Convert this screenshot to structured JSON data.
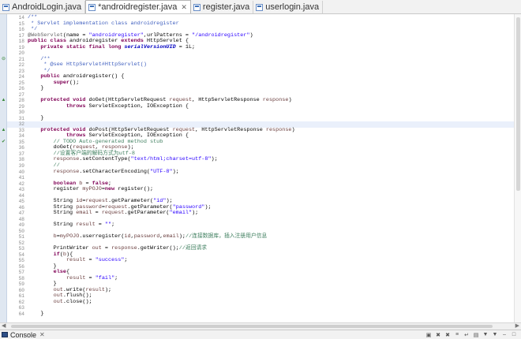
{
  "tabs": [
    {
      "label": "AndroidLogin.java",
      "active": false,
      "closable": false
    },
    {
      "label": "*androidregister.java",
      "active": true,
      "closable": true
    },
    {
      "label": "register.java",
      "active": false,
      "closable": false
    },
    {
      "label": "userlogin.java",
      "active": false,
      "closable": false
    }
  ],
  "code_lines": [
    {
      "n": "14",
      "m": "",
      "t": [
        {
          "c": "jd",
          "s": "/**"
        }
      ]
    },
    {
      "n": "15",
      "m": "",
      "t": [
        {
          "c": "jd",
          "s": " * Servlet implementation class androidregister"
        }
      ]
    },
    {
      "n": "16",
      "m": "",
      "t": [
        {
          "c": "jd",
          "s": " */"
        }
      ]
    },
    {
      "n": "17",
      "m": "",
      "t": [
        {
          "c": "ann",
          "s": "@WebServlet"
        },
        {
          "c": "pl",
          "s": "(name = "
        },
        {
          "c": "str",
          "s": "\"androidregister\""
        },
        {
          "c": "pl",
          "s": ",urlPatterns = "
        },
        {
          "c": "str",
          "s": "\"/androidregister\""
        },
        {
          "c": "pl",
          "s": ")"
        }
      ]
    },
    {
      "n": "18",
      "m": "",
      "t": [
        {
          "c": "kw",
          "s": "public class "
        },
        {
          "c": "pl",
          "s": "androidregister "
        },
        {
          "c": "kw",
          "s": "extends "
        },
        {
          "c": "pl",
          "s": "HttpServlet {"
        }
      ]
    },
    {
      "n": "19",
      "m": "",
      "t": [
        {
          "c": "pl",
          "s": "    "
        },
        {
          "c": "kw",
          "s": "private static final long "
        },
        {
          "c": "fld",
          "s": "serialVersionUID"
        },
        {
          "c": "pl",
          "s": " = 1L;"
        }
      ]
    },
    {
      "n": "20",
      "m": "",
      "t": []
    },
    {
      "n": "21",
      "m": "⊖",
      "t": [
        {
          "c": "pl",
          "s": "    "
        },
        {
          "c": "jd",
          "s": "/**"
        }
      ]
    },
    {
      "n": "22",
      "m": "",
      "t": [
        {
          "c": "jd",
          "s": "     * @see HttpServlet#HttpServlet()"
        }
      ]
    },
    {
      "n": "23",
      "m": "",
      "t": [
        {
          "c": "jd",
          "s": "     */"
        }
      ]
    },
    {
      "n": "24",
      "m": "",
      "t": [
        {
          "c": "pl",
          "s": "    "
        },
        {
          "c": "kw",
          "s": "public "
        },
        {
          "c": "pl",
          "s": "androidregister() {"
        }
      ]
    },
    {
      "n": "25",
      "m": "",
      "t": [
        {
          "c": "pl",
          "s": "        "
        },
        {
          "c": "kw",
          "s": "super"
        },
        {
          "c": "pl",
          "s": "();"
        }
      ]
    },
    {
      "n": "26",
      "m": "",
      "t": [
        {
          "c": "pl",
          "s": "    }"
        }
      ]
    },
    {
      "n": "27",
      "m": "",
      "t": []
    },
    {
      "n": "28",
      "m": "▲",
      "t": [
        {
          "c": "pl",
          "s": "    "
        },
        {
          "c": "kw",
          "s": "protected void "
        },
        {
          "c": "pl",
          "s": "doGet(HttpServletRequest "
        },
        {
          "c": "var",
          "s": "request"
        },
        {
          "c": "pl",
          "s": ", HttpServletResponse "
        },
        {
          "c": "var",
          "s": "response"
        },
        {
          "c": "pl",
          "s": ")"
        }
      ]
    },
    {
      "n": "29",
      "m": "",
      "t": [
        {
          "c": "pl",
          "s": "            "
        },
        {
          "c": "kw",
          "s": "throws "
        },
        {
          "c": "pl",
          "s": "ServletException, IOException {"
        }
      ]
    },
    {
      "n": "30",
      "m": "",
      "t": []
    },
    {
      "n": "31",
      "m": "",
      "t": [
        {
          "c": "pl",
          "s": "    }"
        }
      ]
    },
    {
      "n": "32",
      "m": "",
      "t": []
    },
    {
      "n": "33",
      "m": "▲",
      "t": [
        {
          "c": "pl",
          "s": "    "
        },
        {
          "c": "kw",
          "s": "protected void "
        },
        {
          "c": "pl",
          "s": "doPost(HttpServletRequest "
        },
        {
          "c": "var",
          "s": "request"
        },
        {
          "c": "pl",
          "s": ", HttpServletResponse "
        },
        {
          "c": "var",
          "s": "response"
        },
        {
          "c": "pl",
          "s": ")"
        }
      ]
    },
    {
      "n": "34",
      "m": "",
      "t": [
        {
          "c": "pl",
          "s": "            "
        },
        {
          "c": "kw",
          "s": "throws "
        },
        {
          "c": "pl",
          "s": "ServletException, IOException {"
        }
      ]
    },
    {
      "n": "35",
      "m": "✔",
      "t": [
        {
          "c": "pl",
          "s": "        "
        },
        {
          "c": "cm",
          "s": "// TODO Auto-generated method stub"
        }
      ]
    },
    {
      "n": "36",
      "m": "",
      "t": [
        {
          "c": "pl",
          "s": "        doGet("
        },
        {
          "c": "var",
          "s": "request"
        },
        {
          "c": "pl",
          "s": ", "
        },
        {
          "c": "var",
          "s": "response"
        },
        {
          "c": "pl",
          "s": ");"
        }
      ]
    },
    {
      "n": "37",
      "m": "",
      "t": [
        {
          "c": "pl",
          "s": "        "
        },
        {
          "c": "cm",
          "s": "//设置客户端的解码方式为utf-8"
        }
      ]
    },
    {
      "n": "38",
      "m": "",
      "t": [
        {
          "c": "pl",
          "s": "        "
        },
        {
          "c": "var",
          "s": "response"
        },
        {
          "c": "pl",
          "s": ".setContentType("
        },
        {
          "c": "str",
          "s": "\"text/html;charset=utf-8\""
        },
        {
          "c": "pl",
          "s": ");"
        }
      ]
    },
    {
      "n": "39",
      "m": "",
      "t": [
        {
          "c": "pl",
          "s": "        "
        },
        {
          "c": "cm",
          "s": "//"
        }
      ]
    },
    {
      "n": "40",
      "m": "",
      "t": [
        {
          "c": "pl",
          "s": "        "
        },
        {
          "c": "var",
          "s": "response"
        },
        {
          "c": "pl",
          "s": ".setCharacterEncoding("
        },
        {
          "c": "str",
          "s": "\"UTF-8\""
        },
        {
          "c": "pl",
          "s": ");"
        }
      ]
    },
    {
      "n": "41",
      "m": "",
      "t": []
    },
    {
      "n": "42",
      "m": "",
      "t": [
        {
          "c": "pl",
          "s": "        "
        },
        {
          "c": "kw",
          "s": "boolean "
        },
        {
          "c": "var",
          "s": "b"
        },
        {
          "c": "pl",
          "s": " = "
        },
        {
          "c": "kw",
          "s": "false"
        },
        {
          "c": "pl",
          "s": ";"
        }
      ]
    },
    {
      "n": "43",
      "m": "",
      "t": [
        {
          "c": "pl",
          "s": "        register "
        },
        {
          "c": "var",
          "s": "myPOJO"
        },
        {
          "c": "pl",
          "s": "="
        },
        {
          "c": "kw",
          "s": "new "
        },
        {
          "c": "pl",
          "s": "register();"
        }
      ]
    },
    {
      "n": "44",
      "m": "",
      "t": []
    },
    {
      "n": "45",
      "m": "",
      "t": [
        {
          "c": "pl",
          "s": "        String "
        },
        {
          "c": "var",
          "s": "id"
        },
        {
          "c": "pl",
          "s": "="
        },
        {
          "c": "var",
          "s": "request"
        },
        {
          "c": "pl",
          "s": ".getParameter("
        },
        {
          "c": "str",
          "s": "\"id\""
        },
        {
          "c": "pl",
          "s": ");"
        }
      ]
    },
    {
      "n": "46",
      "m": "",
      "t": [
        {
          "c": "pl",
          "s": "        String "
        },
        {
          "c": "var",
          "s": "password"
        },
        {
          "c": "pl",
          "s": "="
        },
        {
          "c": "var",
          "s": "request"
        },
        {
          "c": "pl",
          "s": ".getParameter("
        },
        {
          "c": "str",
          "s": "\"password\""
        },
        {
          "c": "pl",
          "s": ");"
        }
      ]
    },
    {
      "n": "47",
      "m": "",
      "t": [
        {
          "c": "pl",
          "s": "        String "
        },
        {
          "c": "var",
          "s": "email"
        },
        {
          "c": "pl",
          "s": " = "
        },
        {
          "c": "var",
          "s": "request"
        },
        {
          "c": "pl",
          "s": ".getParameter("
        },
        {
          "c": "str",
          "s": "\"email\""
        },
        {
          "c": "pl",
          "s": ");"
        }
      ]
    },
    {
      "n": "48",
      "m": "",
      "t": []
    },
    {
      "n": "49",
      "m": "",
      "t": [
        {
          "c": "pl",
          "s": "        String "
        },
        {
          "c": "var",
          "s": "result"
        },
        {
          "c": "pl",
          "s": " = "
        },
        {
          "c": "str",
          "s": "\"\""
        },
        {
          "c": "pl",
          "s": ";"
        }
      ]
    },
    {
      "n": "50",
      "m": "",
      "t": []
    },
    {
      "n": "51",
      "m": "",
      "t": [
        {
          "c": "pl",
          "s": "        "
        },
        {
          "c": "var",
          "s": "b"
        },
        {
          "c": "pl",
          "s": "="
        },
        {
          "c": "var",
          "s": "myPOJO"
        },
        {
          "c": "pl",
          "s": ".userregister("
        },
        {
          "c": "var",
          "s": "id"
        },
        {
          "c": "pl",
          "s": ","
        },
        {
          "c": "var",
          "s": "password"
        },
        {
          "c": "pl",
          "s": ","
        },
        {
          "c": "var",
          "s": "email"
        },
        {
          "c": "pl",
          "s": ");"
        },
        {
          "c": "cm",
          "s": "//连接数据库，插入注册用户信息"
        }
      ]
    },
    {
      "n": "52",
      "m": "",
      "t": []
    },
    {
      "n": "53",
      "m": "",
      "t": [
        {
          "c": "pl",
          "s": "        PrintWriter "
        },
        {
          "c": "var",
          "s": "out"
        },
        {
          "c": "pl",
          "s": " = "
        },
        {
          "c": "var",
          "s": "response"
        },
        {
          "c": "pl",
          "s": ".getWriter();"
        },
        {
          "c": "cm",
          "s": "//返回请求"
        }
      ]
    },
    {
      "n": "54",
      "m": "",
      "t": [
        {
          "c": "pl",
          "s": "        "
        },
        {
          "c": "kw",
          "s": "if"
        },
        {
          "c": "pl",
          "s": "("
        },
        {
          "c": "var",
          "s": "b"
        },
        {
          "c": "pl",
          "s": "){"
        }
      ]
    },
    {
      "n": "55",
      "m": "",
      "t": [
        {
          "c": "pl",
          "s": "            "
        },
        {
          "c": "var",
          "s": "result"
        },
        {
          "c": "pl",
          "s": " = "
        },
        {
          "c": "str",
          "s": "\"success\""
        },
        {
          "c": "pl",
          "s": ";"
        }
      ]
    },
    {
      "n": "56",
      "m": "",
      "t": [
        {
          "c": "pl",
          "s": "        }"
        }
      ]
    },
    {
      "n": "57",
      "m": "",
      "t": [
        {
          "c": "pl",
          "s": "        "
        },
        {
          "c": "kw",
          "s": "else"
        },
        {
          "c": "pl",
          "s": "{"
        }
      ]
    },
    {
      "n": "58",
      "m": "",
      "t": [
        {
          "c": "pl",
          "s": "            "
        },
        {
          "c": "var",
          "s": "result"
        },
        {
          "c": "pl",
          "s": " = "
        },
        {
          "c": "str",
          "s": "\"fail\""
        },
        {
          "c": "pl",
          "s": ";"
        }
      ]
    },
    {
      "n": "59",
      "m": "",
      "t": [
        {
          "c": "pl",
          "s": "        }"
        }
      ]
    },
    {
      "n": "60",
      "m": "",
      "t": [
        {
          "c": "pl",
          "s": "        "
        },
        {
          "c": "var",
          "s": "out"
        },
        {
          "c": "pl",
          "s": ".write("
        },
        {
          "c": "var",
          "s": "result"
        },
        {
          "c": "pl",
          "s": ");"
        }
      ]
    },
    {
      "n": "61",
      "m": "",
      "t": [
        {
          "c": "pl",
          "s": "        "
        },
        {
          "c": "var",
          "s": "out"
        },
        {
          "c": "pl",
          "s": ".flush();"
        }
      ]
    },
    {
      "n": "62",
      "m": "",
      "t": [
        {
          "c": "pl",
          "s": "        "
        },
        {
          "c": "var",
          "s": "out"
        },
        {
          "c": "pl",
          "s": ".close();"
        }
      ]
    },
    {
      "n": "63",
      "m": "",
      "t": []
    },
    {
      "n": "64",
      "m": "",
      "t": [
        {
          "c": "pl",
          "s": "    }"
        }
      ]
    }
  ],
  "current_line": "32",
  "console": {
    "label": "Console",
    "close_symbol": "✕"
  },
  "console_toolbar": [
    {
      "name": "clear-console-icon",
      "glyph": "▣"
    },
    {
      "name": "remove-launch-icon",
      "glyph": "✖"
    },
    {
      "name": "remove-all-icon",
      "glyph": "✖"
    },
    {
      "name": "scroll-lock-icon",
      "glyph": "≡"
    },
    {
      "name": "word-wrap-icon",
      "glyph": "↵"
    },
    {
      "name": "pin-console-icon",
      "glyph": "▤"
    },
    {
      "name": "display-console-icon",
      "glyph": "▼"
    },
    {
      "name": "open-console-icon",
      "glyph": "▼"
    },
    {
      "name": "minimize-icon",
      "glyph": "–"
    },
    {
      "name": "maximize-icon",
      "glyph": "□"
    }
  ],
  "tab_close_symbol": "✕"
}
